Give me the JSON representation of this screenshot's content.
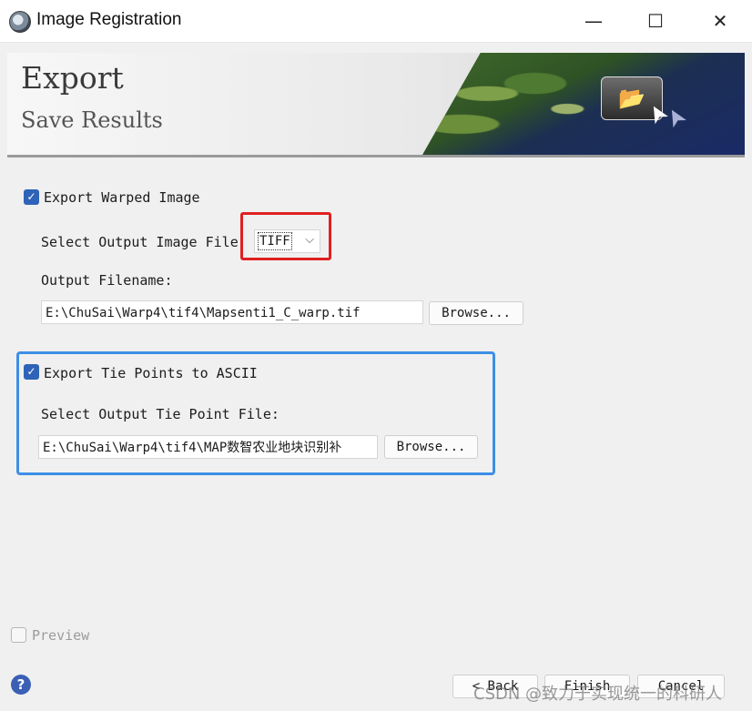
{
  "window": {
    "title": "Image Registration",
    "minimize": "—",
    "maximize": "☐",
    "close": "✕"
  },
  "banner": {
    "title": "Export",
    "subtitle": "Save Results",
    "folder_icon": "📂",
    "cursor_icon": "➤"
  },
  "export_warped": {
    "checkbox_mark": "✓",
    "label": "Export Warped Image",
    "select_label": "Select Output Image File",
    "format_value": "TIFF",
    "format_chevron": "⌵",
    "filename_label": "Output Filename:",
    "filename_value": "E:\\ChuSai\\Warp4\\tif4\\Mapsenti1_C_warp.tif",
    "browse_label": "Browse..."
  },
  "export_tiepoints": {
    "checkbox_mark": "✓",
    "label": "Export Tie Points to ASCII",
    "select_label": "Select Output Tie Point File:",
    "filename_value": "E:\\ChuSai\\Warp4\\tif4\\MAP数智农业地块识别补",
    "browse_label": "Browse..."
  },
  "footer": {
    "preview_label": "Preview",
    "help_icon": "?",
    "back_label": "< Back",
    "finish_label": "Finish",
    "cancel_label": "Cancel",
    "watermark": "CSDN @致力于实现统一的科研人"
  },
  "colors": {
    "highlight_red": "#e02020",
    "highlight_blue": "#3d8fe6",
    "checkbox_blue": "#2f63b8"
  }
}
